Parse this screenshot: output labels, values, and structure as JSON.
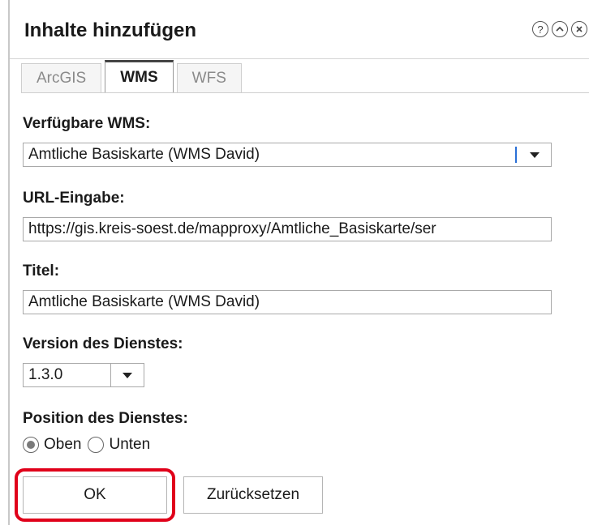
{
  "dialog": {
    "title": "Inhalte hinzufügen",
    "icons": [
      "help-icon",
      "collapse-icon",
      "close-icon"
    ]
  },
  "tabs": [
    {
      "label": "ArcGIS",
      "active": false
    },
    {
      "label": "WMS",
      "active": true
    },
    {
      "label": "WFS",
      "active": false
    }
  ],
  "form": {
    "available_label": "Verfügbare WMS:",
    "available_value": "Amtliche Basiskarte (WMS David)",
    "url_label": "URL-Eingabe:",
    "url_value": "https://gis.kreis-soest.de/mapproxy/Amtliche_Basiskarte/ser",
    "title_label": "Titel:",
    "title_value": "Amtliche Basiskarte (WMS David)",
    "version_label": "Version des Dienstes:",
    "version_value": "1.3.0",
    "position_label": "Position des Dienstes:",
    "position_options": [
      {
        "label": "Oben",
        "selected": true
      },
      {
        "label": "Unten",
        "selected": false
      }
    ]
  },
  "buttons": {
    "ok": "OK",
    "reset": "Zurücksetzen"
  },
  "colors": {
    "highlight": "#e0001a",
    "select_cursor": "#2a6fd6"
  }
}
